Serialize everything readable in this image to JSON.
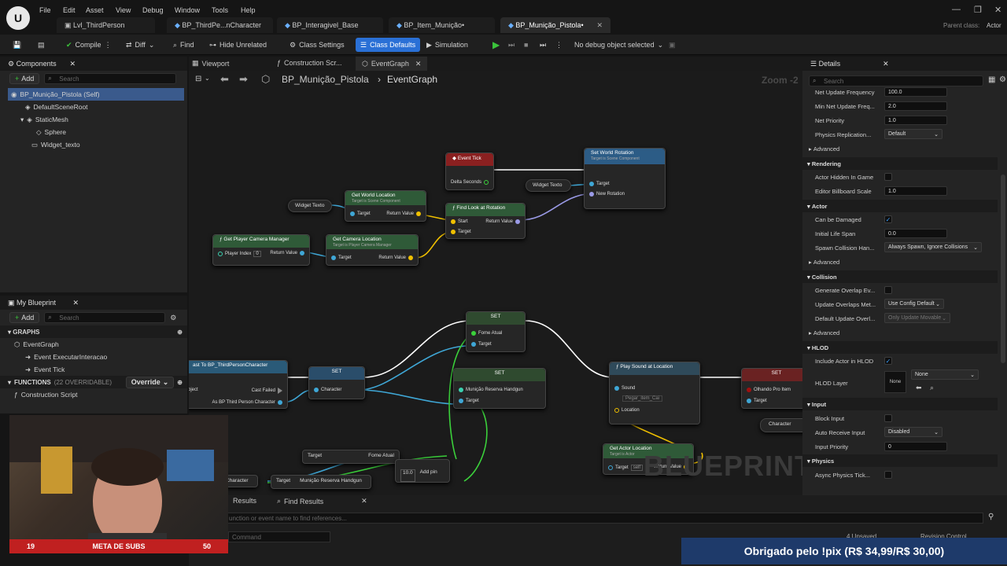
{
  "menu": [
    "File",
    "Edit",
    "Asset",
    "View",
    "Debug",
    "Window",
    "Tools",
    "Help"
  ],
  "tabs": [
    {
      "label": "Lvl_ThirdPerson",
      "active": false
    },
    {
      "label": "BP_ThirdPe...nCharacter",
      "active": false
    },
    {
      "label": "BP_Interagivel_Base",
      "active": false
    },
    {
      "label": "BP_Item_Munição•",
      "active": false
    },
    {
      "label": "BP_Munição_Pistola•",
      "active": true
    }
  ],
  "parent_class": {
    "label": "Parent class:",
    "value": "Actor"
  },
  "toolbar": {
    "compile": "Compile",
    "diff": "Diff",
    "find": "Find",
    "hide_unrelated": "Hide Unrelated",
    "class_settings": "Class Settings",
    "class_defaults": "Class Defaults",
    "simulation": "Simulation",
    "debug_select": "No debug object selected"
  },
  "components": {
    "title": "Components",
    "add": "Add",
    "search_placeholder": "Search",
    "items": [
      "BP_Munição_Pistola (Self)",
      "DefaultSceneRoot",
      "StaticMesh",
      "Sphere",
      "Widget_texto"
    ]
  },
  "my_blueprint": {
    "title": "My Blueprint",
    "add": "Add",
    "search_placeholder": "Search",
    "graphs_label": "GRAPHS",
    "graph": "EventGraph",
    "events": [
      "Event ExecutarInteracao",
      "Event Tick"
    ],
    "functions_label": "FUNCTIONS",
    "functions_count": "(22 OVERRIDABLE)",
    "override": "Override",
    "construction": "Construction Script"
  },
  "graph_tabs": [
    "Viewport",
    "Construction Scr...",
    "EventGraph"
  ],
  "breadcrumb": {
    "bp": "BP_Munição_Pistola",
    "graph": "EventGraph",
    "zoom": "Zoom -2"
  },
  "nodes": {
    "event_tick": {
      "title": "Event Tick",
      "pin": "Delta Seconds"
    },
    "set_world_rotation": {
      "title": "Set World Rotation",
      "sub": "Target is Scene Component",
      "pins": [
        "Target",
        "New Rotation"
      ]
    },
    "widget_texto_a": "Widget Texto",
    "widget_texto_b": "Widget Texto",
    "get_world_location": {
      "title": "Get World Location",
      "sub": "Target is Scene Component",
      "pins": [
        "Target",
        "Return Value"
      ]
    },
    "find_look_at": {
      "title": "Find Look at Rotation",
      "pins": [
        "Start",
        "Target",
        "Return Value"
      ]
    },
    "get_player_camera": {
      "title": "Get Player Camera Manager",
      "pins": [
        "Player Index",
        "0",
        "Return Value"
      ]
    },
    "get_camera_location": {
      "title": "Get Camera Location",
      "sub": "Target is Player Camera Manager",
      "pins": [
        "Target",
        "Return Value"
      ]
    },
    "cast": {
      "title": "ast To BP_ThirdPersonCharacter",
      "pins": [
        "bject",
        "Cast Failed",
        "As BP Third Person Character"
      ]
    },
    "set_1": {
      "title": "SET",
      "pins": [
        "Character"
      ]
    },
    "set_2": {
      "title": "SET",
      "pins": [
        "Fome Atual",
        "Target"
      ]
    },
    "set_3": {
      "title": "SET",
      "pins": [
        "Munição Reserva Handgun",
        "Target"
      ]
    },
    "play_sound": {
      "title": "Play Sound at Location",
      "pins": [
        "Sound",
        "Pegar_item_Cai",
        "Location"
      ]
    },
    "set_4": {
      "title": "SET",
      "pins": [
        "Olhando Pro Item",
        "Target",
        "Character"
      ]
    },
    "get_actor_location": {
      "title": "Get Actor Location",
      "sub": "Target is Actor",
      "pins": [
        "Target",
        "self",
        "Return Value"
      ]
    },
    "bottom_pins": [
      "Target",
      "Fome Atual",
      "Character",
      "Target",
      "Munição Reserva Handgun",
      "10.0",
      "Add pin"
    ]
  },
  "watermark": "BLUEPRINT",
  "details": {
    "title": "Details",
    "search_placeholder": "Search",
    "rows": [
      {
        "label": "Net Update Frequency",
        "value": "100.0"
      },
      {
        "label": "Min Net Update Freq...",
        "value": "2.0"
      },
      {
        "label": "Net Priority",
        "value": "1.0"
      },
      {
        "label": "Physics Replication...",
        "value": "Default"
      }
    ],
    "advanced": "Advanced",
    "rendering": "Rendering",
    "actor_hidden": "Actor Hidden In Game",
    "billboard": {
      "label": "Editor Billboard Scale",
      "value": "1.0"
    },
    "actor": "Actor",
    "can_be_damaged": "Can be Damaged",
    "life_span": {
      "label": "Initial Life Span",
      "value": "0.0"
    },
    "spawn": {
      "label": "Spawn Collision Han...",
      "value": "Always Spawn, Ignore Collisions"
    },
    "collision": "Collision",
    "overlap_events": "Generate Overlap Ev...",
    "update_overlaps": {
      "label": "Update Overlaps Met...",
      "value": "Use Config Default"
    },
    "default_update": {
      "label": "Default Update Overl...",
      "value": "Only Update Movable"
    },
    "hlod": "HLOD",
    "include_hlod": "Include Actor in HLOD",
    "hlod_layer": {
      "label": "HLOD Layer",
      "value": "None",
      "thumb": "None"
    },
    "input": "Input",
    "block_input": "Block Input",
    "auto_receive": {
      "label": "Auto Receive Input",
      "value": "Disabled"
    },
    "input_priority": {
      "label": "Input Priority",
      "value": "0"
    },
    "physics": "Physics",
    "async_tick": "Async Physics Tick..."
  },
  "bottom": {
    "results": "Results",
    "find_results": "Find Results",
    "find_placeholder": "unction or event name to find references...",
    "command": "Command",
    "unsaved": "4 Unsaved",
    "revision": "Revision Control"
  },
  "overlay": {
    "subs_current": "19",
    "subs_label": "META DE SUBS",
    "subs_goal": "50",
    "pix": "Obrigado pelo !pix (R$ 34,99/R$ 30,00)"
  }
}
